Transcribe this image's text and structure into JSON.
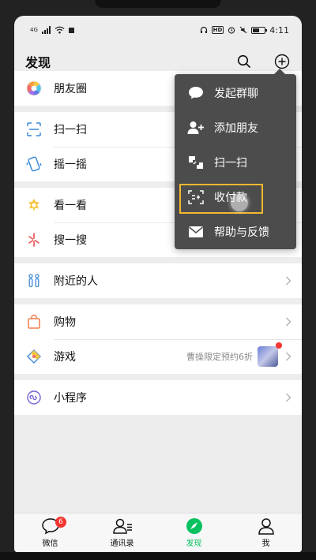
{
  "status_bar": {
    "signal": "4G",
    "time": "4:11",
    "hd": "HD"
  },
  "header": {
    "title": "发现"
  },
  "groups": [
    {
      "items": [
        {
          "label": "朋友圈",
          "icon": "moments-icon"
        }
      ]
    },
    {
      "items": [
        {
          "label": "扫一扫",
          "icon": "scan-icon"
        },
        {
          "label": "摇一摇",
          "icon": "shake-icon"
        }
      ]
    },
    {
      "items": [
        {
          "label": "看一看",
          "icon": "top-stories-icon"
        },
        {
          "label": "搜一搜",
          "icon": "search-feature-icon"
        }
      ]
    },
    {
      "items": [
        {
          "label": "附近的人",
          "icon": "people-nearby-icon"
        }
      ]
    },
    {
      "items": [
        {
          "label": "购物",
          "icon": "shopping-icon"
        },
        {
          "label": "游戏",
          "icon": "games-icon",
          "extra": "曹操限定预约6折"
        }
      ]
    },
    {
      "items": [
        {
          "label": "小程序",
          "icon": "mini-programs-icon"
        }
      ]
    }
  ],
  "popup_menu": {
    "items": [
      {
        "label": "发起群聊",
        "icon": "group-chat-icon"
      },
      {
        "label": "添加朋友",
        "icon": "add-friend-icon"
      },
      {
        "label": "扫一扫",
        "icon": "scan-icon"
      },
      {
        "label": "收付款",
        "icon": "money-icon"
      },
      {
        "label": "帮助与反馈",
        "icon": "feedback-icon"
      }
    ]
  },
  "tabbar": {
    "items": [
      {
        "label": "微信",
        "badge": "6"
      },
      {
        "label": "通讯录"
      },
      {
        "label": "发现"
      },
      {
        "label": "我"
      }
    ]
  },
  "colors": {
    "accent": "#07c160",
    "badge": "#f43530",
    "highlight": "#f5b82e",
    "popup_bg": "#4c4c4c"
  }
}
